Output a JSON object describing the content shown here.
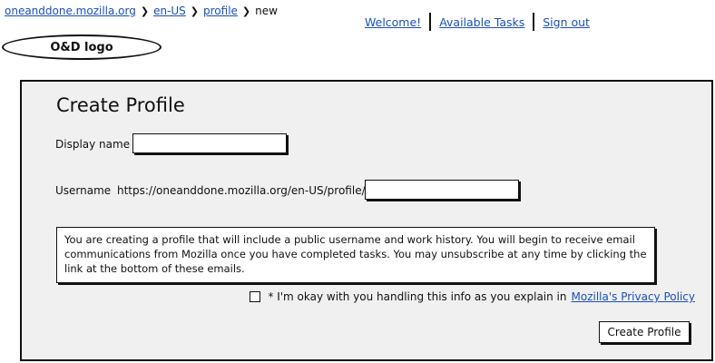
{
  "breadcrumb": {
    "items": [
      "oneanddone.mozilla.org",
      "en-US",
      "profile"
    ],
    "current": "new",
    "separator": "❯"
  },
  "top_nav": {
    "welcome": "Welcome!",
    "available_tasks": "Available Tasks",
    "sign_out": "Sign out"
  },
  "logo": {
    "text": "O&D logo"
  },
  "form": {
    "title": "Create Profile",
    "display_name_label": "Display name",
    "display_name_value": "",
    "username_label": "Username",
    "username_prefix": "https://oneanddone.mozilla.org/en-US/profile/",
    "username_value": "",
    "notice": "You are creating a profile that will include a public username and work history. You will begin to receive email communications from Mozilla once you have completed tasks. You may unsubscribe at any time by clicking the link at the bottom of these emails.",
    "consent_text": "* I'm okay with you handling this info as you explain in",
    "consent_link": "Mozilla's Privacy Policy",
    "consent_checked": false,
    "submit_label": "Create Profile"
  }
}
